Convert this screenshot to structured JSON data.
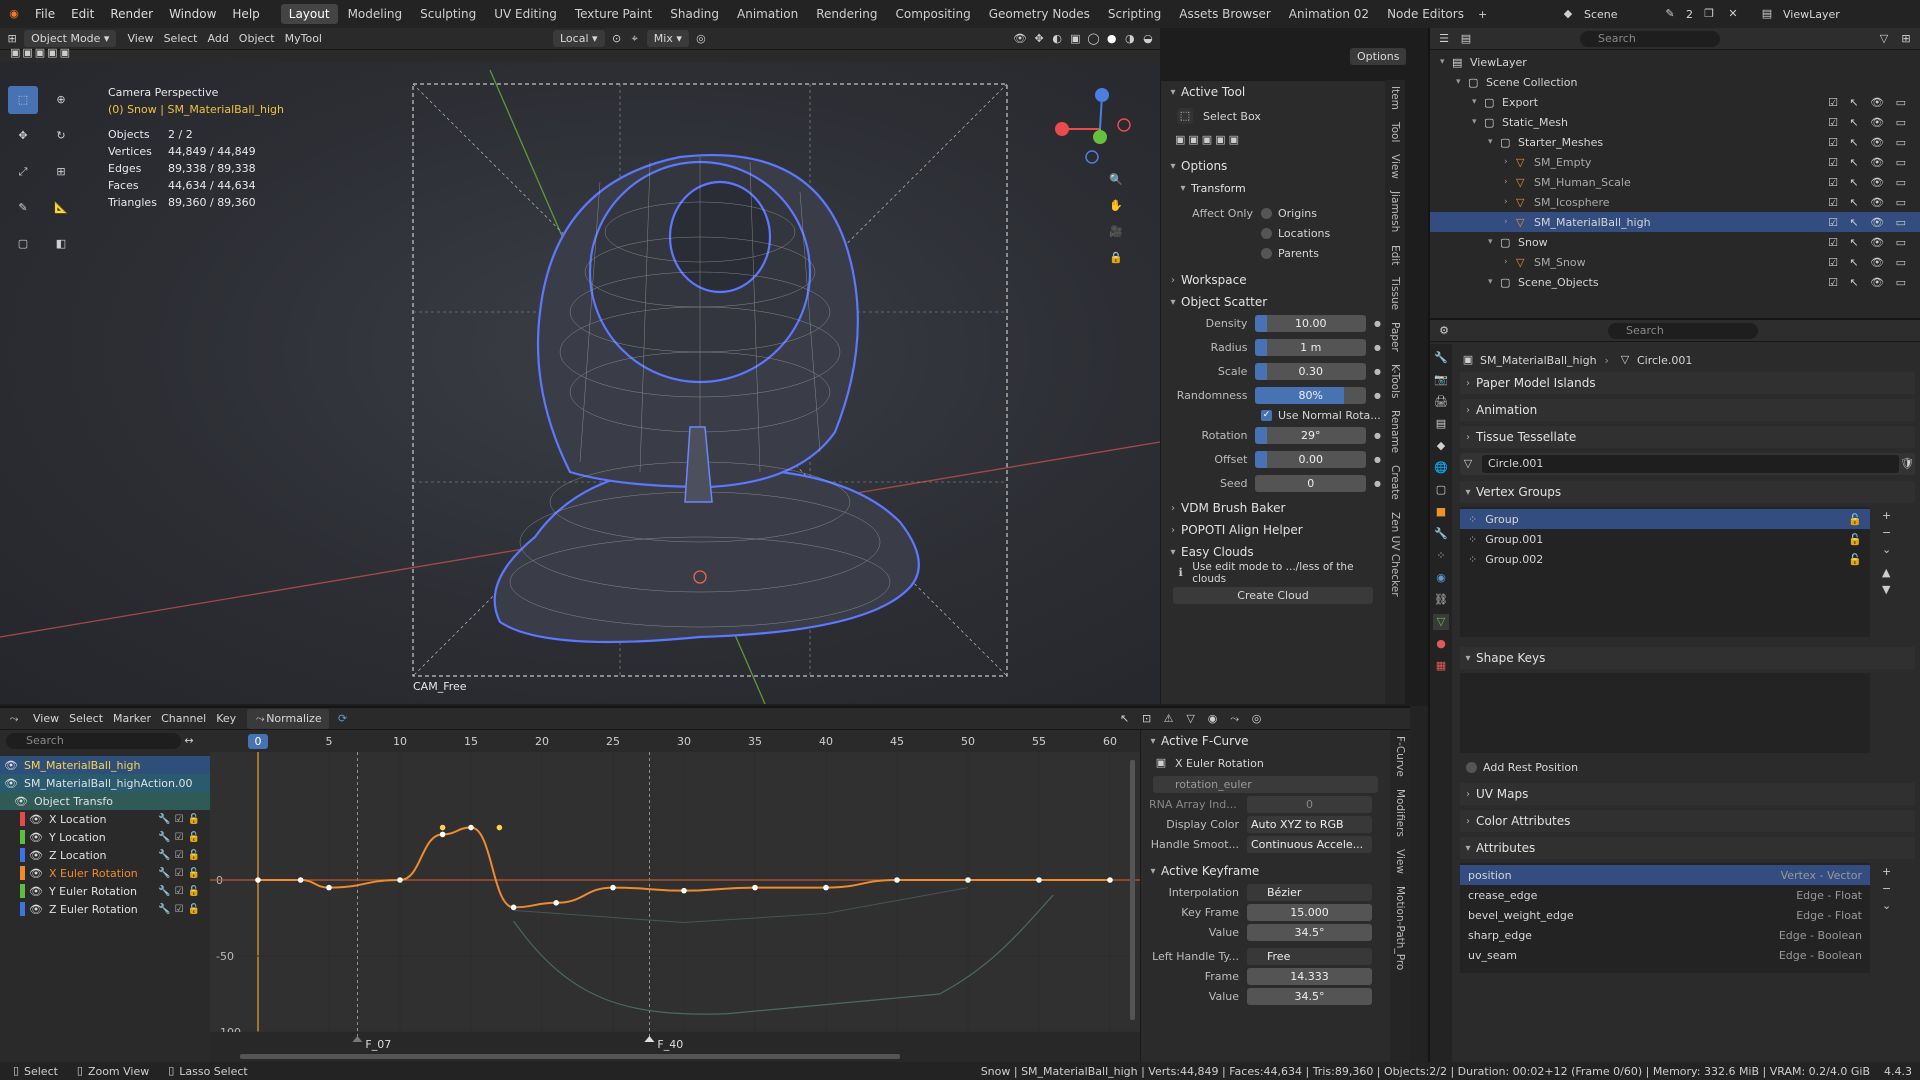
{
  "menu": [
    "File",
    "Edit",
    "Render",
    "Window",
    "Help"
  ],
  "workspaces": [
    "Layout",
    "Modeling",
    "Sculpting",
    "UV Editing",
    "Texture Paint",
    "Shading",
    "Animation",
    "Rendering",
    "Compositing",
    "Geometry Nodes",
    "Scripting",
    "Assets Browser",
    "Animation 02",
    "Node Editors"
  ],
  "active_workspace": "Layout",
  "scene": {
    "name": "Scene",
    "users": "2",
    "view_layer": "ViewLayer"
  },
  "viewport_header": {
    "mode": "Object Mode",
    "menus": [
      "View",
      "Select",
      "Add",
      "Object",
      "MyTool"
    ],
    "orientation": "Local",
    "snap": "Mix",
    "options": "Options"
  },
  "viewport_info": {
    "title": "Camera Perspective",
    "subtitle": "(0) Snow | SM_MaterialBall_high",
    "stats": [
      [
        "Objects",
        "2 / 2"
      ],
      [
        "Vertices",
        "44,849 / 44,849"
      ],
      [
        "Edges",
        "89,338 / 89,338"
      ],
      [
        "Faces",
        "44,634 / 44,634"
      ],
      [
        "Triangles",
        "89,360 / 89,360"
      ]
    ],
    "camera_label": "CAM_Free"
  },
  "sidebar": {
    "active_tool_title": "Active Tool",
    "tool_name": "Select Box",
    "options_title": "Options",
    "transform_title": "Transform",
    "affect_only_label": "Affect Only",
    "affect_only": [
      "Origins",
      "Locations",
      "Parents"
    ],
    "workspace_title": "Workspace",
    "scatter_title": "Object Scatter",
    "scatter": [
      {
        "label": "Density",
        "value": "10.00",
        "fill": 0.1
      },
      {
        "label": "Radius",
        "value": "1 m",
        "fill": 0.1
      },
      {
        "label": "Scale",
        "value": "0.30",
        "fill": 0.1
      },
      {
        "label": "Randomness",
        "value": "80%",
        "fill": 0.8
      }
    ],
    "use_normal": "Use Normal Rota...",
    "scatter2": [
      {
        "label": "Rotation",
        "value": "29°",
        "fill": 0.1
      },
      {
        "label": "Offset",
        "value": "0.00",
        "fill": 0.1
      },
      {
        "label": "Seed",
        "value": "0",
        "fill": 0
      }
    ],
    "collapsed": [
      "VDM Brush Baker",
      "POPOTI Align Helper"
    ],
    "clouds_title": "Easy Clouds",
    "clouds_hint": "Use edit mode to .../less of the clouds",
    "create_cloud": "Create Cloud",
    "tabs": [
      "Item",
      "Tool",
      "View",
      "Jiamesh",
      "Edit",
      "Tissue",
      "Paper",
      "K-Tools",
      "Rename",
      "Create",
      "Zen UV Checker"
    ]
  },
  "outliner": {
    "search": "Search",
    "rows": [
      {
        "label": "ViewLayer",
        "indent": 0
      },
      {
        "label": "Scene Collection",
        "indent": 1
      },
      {
        "label": "Export",
        "indent": 2
      },
      {
        "label": "Static_Mesh",
        "indent": 2
      },
      {
        "label": "Starter_Meshes",
        "indent": 3
      },
      {
        "label": "SM_Empty",
        "indent": 4
      },
      {
        "label": "SM_Human_Scale",
        "indent": 4
      },
      {
        "label": "SM_Icosphere",
        "indent": 4
      },
      {
        "label": "SM_MaterialBall_high",
        "indent": 4,
        "selected": true
      },
      {
        "label": "Snow",
        "indent": 3
      },
      {
        "label": "SM_Snow",
        "indent": 4
      },
      {
        "label": "Scene_Objects",
        "indent": 3
      }
    ]
  },
  "properties": {
    "search": "Search",
    "breadcrumb": [
      "SM_MaterialBall_high",
      "Circle.001"
    ],
    "collapsed_top": [
      "Paper Model Islands",
      "Animation",
      "Tissue Tessellate"
    ],
    "mesh_name": "Circle.001",
    "vertex_groups_title": "Vertex Groups",
    "vertex_groups": [
      "Group",
      "Group.001",
      "Group.002"
    ],
    "shape_keys_title": "Shape Keys",
    "add_rest": "Add Rest Position",
    "collapsed_mid": [
      "UV Maps",
      "Color Attributes"
    ],
    "attributes_title": "Attributes",
    "attributes": [
      {
        "name": "position",
        "type": "Vertex - Vector"
      },
      {
        "name": "crease_edge",
        "type": "Edge - Float"
      },
      {
        "name": "bevel_weight_edge",
        "type": "Edge - Float"
      },
      {
        "name": "sharp_edge",
        "type": "Edge - Boolean"
      },
      {
        "name": "uv_seam",
        "type": "Edge - Boolean"
      }
    ]
  },
  "graph": {
    "menus": [
      "View",
      "Select",
      "Marker",
      "Channel",
      "Key"
    ],
    "normalize": "Normalize",
    "search": "Search",
    "frames": [
      "0",
      "5",
      "10",
      "15",
      "20",
      "25",
      "30",
      "35",
      "40",
      "45",
      "50",
      "55",
      "60"
    ],
    "yticks": [
      "0",
      "-50",
      "-100"
    ],
    "markers": [
      "F_07",
      "F_40"
    ],
    "channels": [
      {
        "label": "SM_MaterialBall_high",
        "color": "#ffd24a"
      },
      {
        "label": "SM_MaterialBall_highAction.00",
        "color": "#d8e6ff"
      },
      {
        "label": "Object Transfo",
        "color": "#e6e6e6"
      },
      {
        "label": "X Location",
        "color": "#e34b4b"
      },
      {
        "label": "Y Location",
        "color": "#5fbf3c"
      },
      {
        "label": "Z Location",
        "color": "#3e74e0"
      },
      {
        "label": "X Euler Rotation",
        "color": "#f08a2e"
      },
      {
        "label": "Y Euler Rotation",
        "color": "#5fbf3c"
      },
      {
        "label": "Z Euler Rotation",
        "color": "#3e74e0"
      }
    ]
  },
  "fcurve_panel": {
    "active_fcurve_title": "Active F-Curve",
    "fcurve_name": "X Euler Rotation",
    "data_path": "rotation_euler",
    "rna_label": "RNA Array Ind...",
    "rna_value": "0",
    "display_color_label": "Display Color",
    "display_color": "Auto XYZ to RGB",
    "handle_smooth_label": "Handle Smoot...",
    "handle_smooth": "Continuous Accele...",
    "active_keyframe_title": "Active Keyframe",
    "interp_label": "Interpolation",
    "interp": "Bézier",
    "keyframe_label": "Key Frame",
    "keyframe": "15.000",
    "value_label": "Value",
    "value": "34.5°",
    "left_handle_label": "Left Handle Ty...",
    "left_handle": "Free",
    "frame_label": "Frame",
    "frame": "14.333",
    "value2_label": "Value",
    "value2": "34.5°",
    "tabs": [
      "F-Curve",
      "Modifiers",
      "View",
      "Motion-Path_Pro"
    ]
  },
  "statusbar": {
    "hints": [
      "Select",
      "Zoom View",
      "Lasso Select"
    ],
    "info": "Snow | SM_MaterialBall_high | Verts:44,849 | Faces:44,634 | Tris:89,360 | Objects:2/2 | Duration: 00:02+12 (Frame 0/60) | Memory: 332.6 MiB | VRAM: 0.2/4.0 GiB",
    "version": "4.4.3"
  }
}
